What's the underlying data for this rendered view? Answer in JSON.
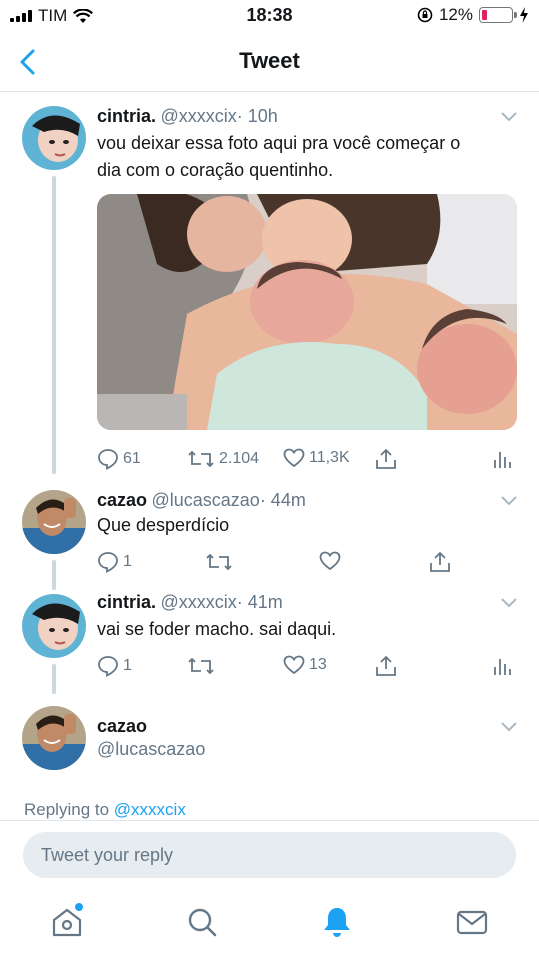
{
  "status_bar": {
    "carrier": "TIM",
    "time": "18:38",
    "battery": "12%",
    "battery_level": 0.12
  },
  "header": {
    "title": "Tweet",
    "back_icon": "chevron-left-icon"
  },
  "tweets": [
    {
      "name": "cintria.",
      "handle": "@xxxxcix",
      "time": "· 10h",
      "text_line1": "vou deixar essa foto aqui pra você começar o",
      "text_line2": "dia com o coração quentinho.",
      "replies": "61",
      "retweets": "2.104",
      "likes": "11,3K"
    },
    {
      "name": "cazao",
      "handle": "@lucascazao",
      "time": "· 44m",
      "text": "Que desperdício",
      "replies": "1"
    },
    {
      "name": "cintria.",
      "handle": "@xxxxcix",
      "time": "· 41m",
      "text": "vai se foder macho. sai daqui.",
      "replies": "1",
      "likes": "13"
    }
  ],
  "reply_author": {
    "name": "cazao",
    "handle": "@lucascazao"
  },
  "replying_to": {
    "prefix": "Replying to",
    "mention": "@xxxxcix"
  },
  "composer": {
    "placeholder": "Tweet your reply"
  },
  "tabs": [
    "home-icon",
    "search-icon",
    "notifications-icon",
    "messages-icon"
  ],
  "colors": {
    "accent": "#1da1f2",
    "text": "#14171a",
    "secondary": "#657786",
    "divider": "#e1e8ed"
  }
}
